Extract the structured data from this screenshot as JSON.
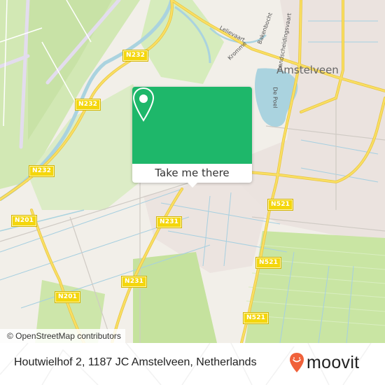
{
  "map": {
    "road_shields": [
      {
        "id": "n232-a",
        "text": "N232"
      },
      {
        "id": "n232-b",
        "text": "N232"
      },
      {
        "id": "n232-c",
        "text": "N232"
      },
      {
        "id": "n201-a",
        "text": "N201"
      },
      {
        "id": "n201-b",
        "text": "N201"
      },
      {
        "id": "n231-a",
        "text": "N231"
      },
      {
        "id": "n231-b",
        "text": "N231"
      },
      {
        "id": "n521-a",
        "text": "N521"
      },
      {
        "id": "n521-b",
        "text": "N521"
      },
      {
        "id": "n521-c",
        "text": "N521"
      }
    ],
    "city_label": "Amstelveen",
    "street_labels": {
      "lelievaart": "Lelievaart",
      "kromme": "Kromme",
      "bakenbocht": "Bakenbocht",
      "landscheidingsvaart": "Landscheidingsvaart",
      "de_poel": "De Poel"
    },
    "attribution": "© OpenStreetMap contributors",
    "colors": {
      "land": "#f2efe9",
      "green": "#c8e6a0",
      "water": "#aad3df",
      "road_major": "#f7d84a",
      "residential": "#e8dedc"
    }
  },
  "popup": {
    "icon": "map-pin-icon",
    "button_label": "Take me there",
    "color": "#1eb76a"
  },
  "footer": {
    "address": "Houtwielhof 2, 1187 JC Amstelveen, Netherlands",
    "brand": "moovit",
    "brand_color": "#f0613a"
  }
}
